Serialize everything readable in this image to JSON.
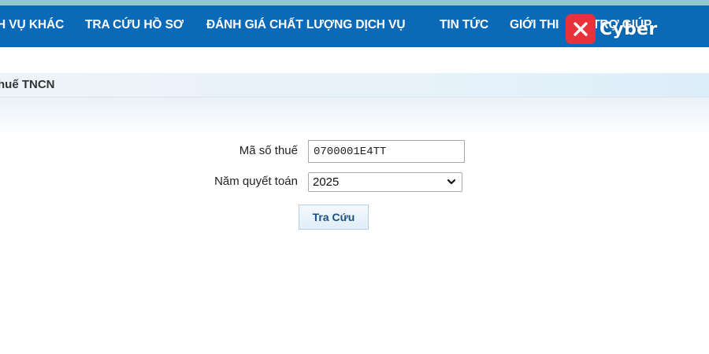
{
  "nav": {
    "items": [
      {
        "label": "H VỤ KHÁC"
      },
      {
        "label": "TRA CỨU HỒ SƠ"
      },
      {
        "label": "ĐÁNH GIÁ CHẤT LƯỢNG DỊCH VỤ"
      },
      {
        "label": "TIN TỨC"
      },
      {
        "label": "GIỚI THI"
      },
      {
        "label": "TRỢ GIÚP"
      }
    ],
    "background_color": "#0a6ab8"
  },
  "watermark": {
    "text": "Cyber",
    "badge_color": "#e8333a",
    "icon": "close-x-icon"
  },
  "section": {
    "title": "huế TNCN"
  },
  "form": {
    "tax_code_label": "Mã số thuế",
    "tax_code_value": "0700001E4TT",
    "year_label": "Năm quyết toán",
    "year_value": "2025",
    "year_chevron_icon": "chevron-down-icon",
    "search_label": "Tra Cứu"
  }
}
